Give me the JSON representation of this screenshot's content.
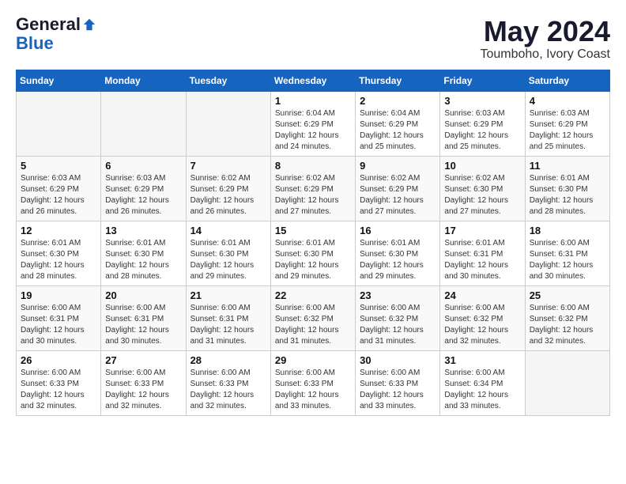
{
  "header": {
    "logo_general": "General",
    "logo_blue": "Blue",
    "title": "May 2024",
    "subtitle": "Toumboho, Ivory Coast"
  },
  "weekdays": [
    "Sunday",
    "Monday",
    "Tuesday",
    "Wednesday",
    "Thursday",
    "Friday",
    "Saturday"
  ],
  "weeks": [
    [
      {
        "day": "",
        "info": ""
      },
      {
        "day": "",
        "info": ""
      },
      {
        "day": "",
        "info": ""
      },
      {
        "day": "1",
        "info": "Sunrise: 6:04 AM\nSunset: 6:29 PM\nDaylight: 12 hours and 24 minutes."
      },
      {
        "day": "2",
        "info": "Sunrise: 6:04 AM\nSunset: 6:29 PM\nDaylight: 12 hours and 25 minutes."
      },
      {
        "day": "3",
        "info": "Sunrise: 6:03 AM\nSunset: 6:29 PM\nDaylight: 12 hours and 25 minutes."
      },
      {
        "day": "4",
        "info": "Sunrise: 6:03 AM\nSunset: 6:29 PM\nDaylight: 12 hours and 25 minutes."
      }
    ],
    [
      {
        "day": "5",
        "info": "Sunrise: 6:03 AM\nSunset: 6:29 PM\nDaylight: 12 hours and 26 minutes."
      },
      {
        "day": "6",
        "info": "Sunrise: 6:03 AM\nSunset: 6:29 PM\nDaylight: 12 hours and 26 minutes."
      },
      {
        "day": "7",
        "info": "Sunrise: 6:02 AM\nSunset: 6:29 PM\nDaylight: 12 hours and 26 minutes."
      },
      {
        "day": "8",
        "info": "Sunrise: 6:02 AM\nSunset: 6:29 PM\nDaylight: 12 hours and 27 minutes."
      },
      {
        "day": "9",
        "info": "Sunrise: 6:02 AM\nSunset: 6:29 PM\nDaylight: 12 hours and 27 minutes."
      },
      {
        "day": "10",
        "info": "Sunrise: 6:02 AM\nSunset: 6:30 PM\nDaylight: 12 hours and 27 minutes."
      },
      {
        "day": "11",
        "info": "Sunrise: 6:01 AM\nSunset: 6:30 PM\nDaylight: 12 hours and 28 minutes."
      }
    ],
    [
      {
        "day": "12",
        "info": "Sunrise: 6:01 AM\nSunset: 6:30 PM\nDaylight: 12 hours and 28 minutes."
      },
      {
        "day": "13",
        "info": "Sunrise: 6:01 AM\nSunset: 6:30 PM\nDaylight: 12 hours and 28 minutes."
      },
      {
        "day": "14",
        "info": "Sunrise: 6:01 AM\nSunset: 6:30 PM\nDaylight: 12 hours and 29 minutes."
      },
      {
        "day": "15",
        "info": "Sunrise: 6:01 AM\nSunset: 6:30 PM\nDaylight: 12 hours and 29 minutes."
      },
      {
        "day": "16",
        "info": "Sunrise: 6:01 AM\nSunset: 6:30 PM\nDaylight: 12 hours and 29 minutes."
      },
      {
        "day": "17",
        "info": "Sunrise: 6:01 AM\nSunset: 6:31 PM\nDaylight: 12 hours and 30 minutes."
      },
      {
        "day": "18",
        "info": "Sunrise: 6:00 AM\nSunset: 6:31 PM\nDaylight: 12 hours and 30 minutes."
      }
    ],
    [
      {
        "day": "19",
        "info": "Sunrise: 6:00 AM\nSunset: 6:31 PM\nDaylight: 12 hours and 30 minutes."
      },
      {
        "day": "20",
        "info": "Sunrise: 6:00 AM\nSunset: 6:31 PM\nDaylight: 12 hours and 30 minutes."
      },
      {
        "day": "21",
        "info": "Sunrise: 6:00 AM\nSunset: 6:31 PM\nDaylight: 12 hours and 31 minutes."
      },
      {
        "day": "22",
        "info": "Sunrise: 6:00 AM\nSunset: 6:32 PM\nDaylight: 12 hours and 31 minutes."
      },
      {
        "day": "23",
        "info": "Sunrise: 6:00 AM\nSunset: 6:32 PM\nDaylight: 12 hours and 31 minutes."
      },
      {
        "day": "24",
        "info": "Sunrise: 6:00 AM\nSunset: 6:32 PM\nDaylight: 12 hours and 32 minutes."
      },
      {
        "day": "25",
        "info": "Sunrise: 6:00 AM\nSunset: 6:32 PM\nDaylight: 12 hours and 32 minutes."
      }
    ],
    [
      {
        "day": "26",
        "info": "Sunrise: 6:00 AM\nSunset: 6:33 PM\nDaylight: 12 hours and 32 minutes."
      },
      {
        "day": "27",
        "info": "Sunrise: 6:00 AM\nSunset: 6:33 PM\nDaylight: 12 hours and 32 minutes."
      },
      {
        "day": "28",
        "info": "Sunrise: 6:00 AM\nSunset: 6:33 PM\nDaylight: 12 hours and 32 minutes."
      },
      {
        "day": "29",
        "info": "Sunrise: 6:00 AM\nSunset: 6:33 PM\nDaylight: 12 hours and 33 minutes."
      },
      {
        "day": "30",
        "info": "Sunrise: 6:00 AM\nSunset: 6:33 PM\nDaylight: 12 hours and 33 minutes."
      },
      {
        "day": "31",
        "info": "Sunrise: 6:00 AM\nSunset: 6:34 PM\nDaylight: 12 hours and 33 minutes."
      },
      {
        "day": "",
        "info": ""
      }
    ]
  ]
}
